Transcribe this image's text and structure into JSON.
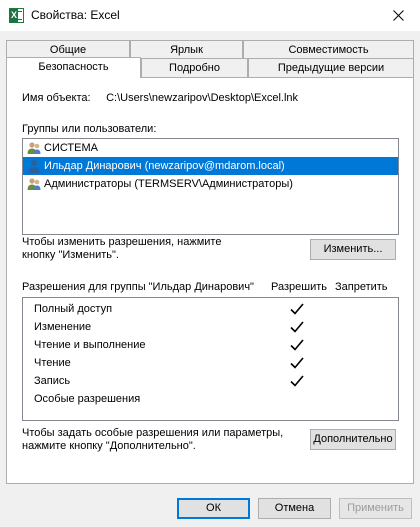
{
  "window": {
    "title": "Свойства: Excel",
    "icon": "excel-icon"
  },
  "tabs": {
    "row1": [
      {
        "label": "Общие",
        "width": 124
      },
      {
        "label": "Ярлык",
        "width": 113
      },
      {
        "label": "Совместимость",
        "width": 171
      }
    ],
    "row2": [
      {
        "label": "Безопасность",
        "width": 135
      },
      {
        "label": "Подробно",
        "width": 107
      },
      {
        "label": "Предыдущие версии",
        "width": 166
      }
    ],
    "active": "Безопасность"
  },
  "object": {
    "label": "Имя объекта:",
    "value": "C:\\Users\\newzaripov\\Desktop\\Excel.lnk"
  },
  "groups": {
    "label": "Группы или пользователи:",
    "items": [
      {
        "name": "СИСТЕМА",
        "icon": "group-icon",
        "selected": false
      },
      {
        "name": "Ильдар Динарович (newzaripov@mdarom.local)",
        "icon": "user-icon",
        "selected": true
      },
      {
        "name": "Администраторы (TERMSERV\\Администраторы)",
        "icon": "group-icon",
        "selected": false
      }
    ]
  },
  "change": {
    "hint_line1": "Чтобы изменить разрешения, нажмите",
    "hint_line2": "кнопку \"Изменить\".",
    "button": "Изменить..."
  },
  "permissions": {
    "label": "Разрешения для группы \"Ильдар Динарович\"",
    "allow_header": "Разрешить",
    "deny_header": "Запретить",
    "rows": [
      {
        "name": "Полный доступ",
        "allow": true,
        "deny": false
      },
      {
        "name": "Изменение",
        "allow": true,
        "deny": false
      },
      {
        "name": "Чтение и выполнение",
        "allow": true,
        "deny": false
      },
      {
        "name": "Чтение",
        "allow": true,
        "deny": false
      },
      {
        "name": "Запись",
        "allow": true,
        "deny": false
      },
      {
        "name": "Особые разрешения",
        "allow": false,
        "deny": false
      }
    ]
  },
  "advanced": {
    "hint_line1": "Чтобы задать особые разрешения или параметры,",
    "hint_line2": "нажмите кнопку \"Дополнительно\".",
    "button": "Дополнительно"
  },
  "footer": {
    "ok": "ОК",
    "cancel": "Отмена",
    "apply": "Применить"
  },
  "colors": {
    "selection": "#0078d7",
    "excel_green": "#1e7145"
  }
}
